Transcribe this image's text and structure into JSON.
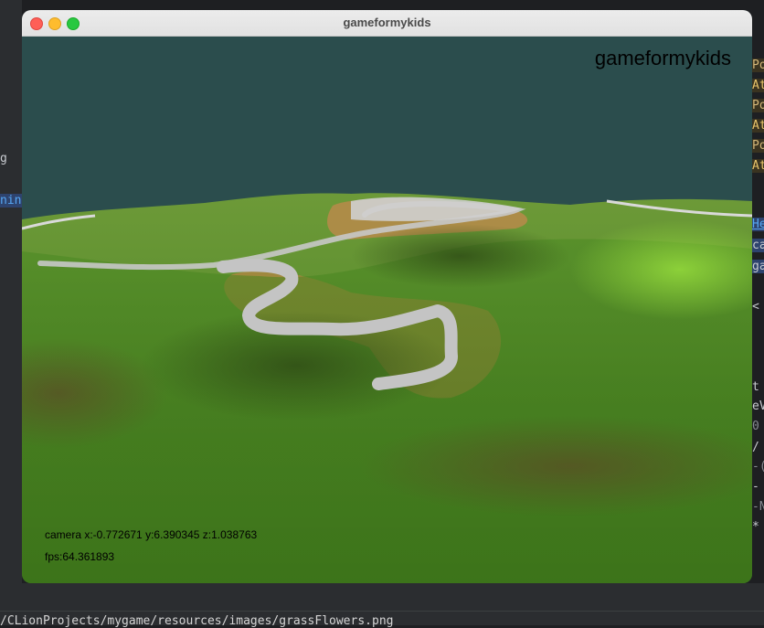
{
  "window": {
    "title": "gameformykids"
  },
  "game": {
    "overlay_title": "gameformykids",
    "camera_readout": "camera x:-0.772671 y:6.390345 z:1.038763",
    "fps_readout": "fps:64.361893"
  },
  "ide": {
    "left_fragments": [
      "g",
      "ning"
    ],
    "right_fragments": [
      "Po",
      "At",
      "Po",
      "At",
      "Po",
      "At",
      "He",
      "ca",
      "ga",
      "<",
      "t",
      "eV",
      "0",
      "/",
      "-(",
      "-",
      "-N",
      "*"
    ],
    "path_text": "/CLionProjects/mygame/resources/images/grassFlowers.png"
  },
  "colors": {
    "sky": "#2b4d4d",
    "grass": "#4f8a1f",
    "path": "#b8b8b8",
    "dirt": "#b98a4a"
  }
}
